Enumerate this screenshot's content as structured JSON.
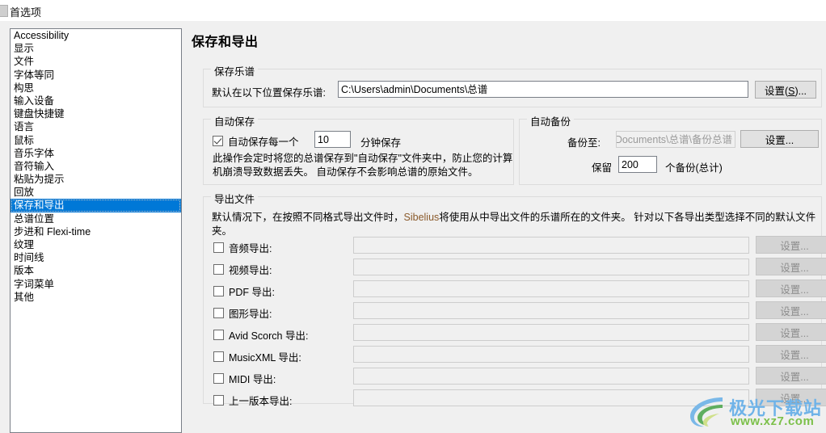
{
  "window": {
    "title": "首选项",
    "icon": "app-icon"
  },
  "sidebar": {
    "items": [
      {
        "label": "Accessibility",
        "selected": false
      },
      {
        "label": "显示",
        "selected": false
      },
      {
        "label": "文件",
        "selected": false
      },
      {
        "label": "字体等同",
        "selected": false
      },
      {
        "label": "构思",
        "selected": false
      },
      {
        "label": "输入设备",
        "selected": false
      },
      {
        "label": "键盘快捷键",
        "selected": false
      },
      {
        "label": "语言",
        "selected": false
      },
      {
        "label": "鼠标",
        "selected": false
      },
      {
        "label": "音乐字体",
        "selected": false
      },
      {
        "label": "音符输入",
        "selected": false
      },
      {
        "label": "粘贴为提示",
        "selected": false
      },
      {
        "label": "回放",
        "selected": false
      },
      {
        "label": "保存和导出",
        "selected": true
      },
      {
        "label": "总谱位置",
        "selected": false
      },
      {
        "label": "步进和 Flexi-time",
        "selected": false
      },
      {
        "label": "纹理",
        "selected": false
      },
      {
        "label": "时间线",
        "selected": false
      },
      {
        "label": "版本",
        "selected": false
      },
      {
        "label": "字词菜单",
        "selected": false
      },
      {
        "label": "其他",
        "selected": false
      }
    ]
  },
  "main": {
    "page_title": "保存和导出",
    "save_score": {
      "legend": "保存乐谱",
      "path_label": "默认在以下位置保存乐谱:",
      "path_value": "C:\\Users\\admin\\Documents\\总谱",
      "settings_button": "设置(S)...",
      "settings_mnemonic": "S"
    },
    "autosave": {
      "legend": "自动保存",
      "checkbox_label": "自动保存每一个",
      "checked": true,
      "minutes_value": "10",
      "minutes_suffix": "分钟保存",
      "description_line1": "此操作会定时将您的总谱保存到\"自动保存\"文件夹中，防止您的计算",
      "description_line2": "机崩溃导致数据丢失。 自动保存不会影响总谱的原始文件。"
    },
    "autobackup": {
      "legend": "自动备份",
      "backup_to_label": "备份至:",
      "backup_to_value": "dmin\\Documents\\总谱\\备份总谱",
      "settings_button": "设置...",
      "keep_label": "保留",
      "keep_value": "200",
      "keep_suffix": "个备份(总计)"
    },
    "export": {
      "legend": "导出文件",
      "description_prefix": "默认情况下，在按照不同格式导出文件时，",
      "description_brand": "Sibelius",
      "description_suffix": "将使用从中导出文件的乐谱所在的文件夹。 针对以下各导出类型选择不同的默认文件夹。",
      "settings_button": "设置...",
      "rows": [
        {
          "label": "音频导出:",
          "checked": false,
          "value": ""
        },
        {
          "label": "视频导出:",
          "checked": false,
          "value": ""
        },
        {
          "label": "PDF 导出:",
          "checked": false,
          "value": ""
        },
        {
          "label": "图形导出:",
          "checked": false,
          "value": ""
        },
        {
          "label": "Avid Scorch 导出:",
          "checked": false,
          "value": ""
        },
        {
          "label": "MusicXML 导出:",
          "checked": false,
          "value": ""
        },
        {
          "label": "MIDI 导出:",
          "checked": false,
          "value": ""
        },
        {
          "label": "上一版本导出:",
          "checked": false,
          "value": ""
        }
      ]
    }
  },
  "watermark": {
    "title": "极光下载站",
    "url": "www.xz7.com",
    "logo_color_blue": "#6fb3e8",
    "logo_color_green": "#7cc04a"
  }
}
